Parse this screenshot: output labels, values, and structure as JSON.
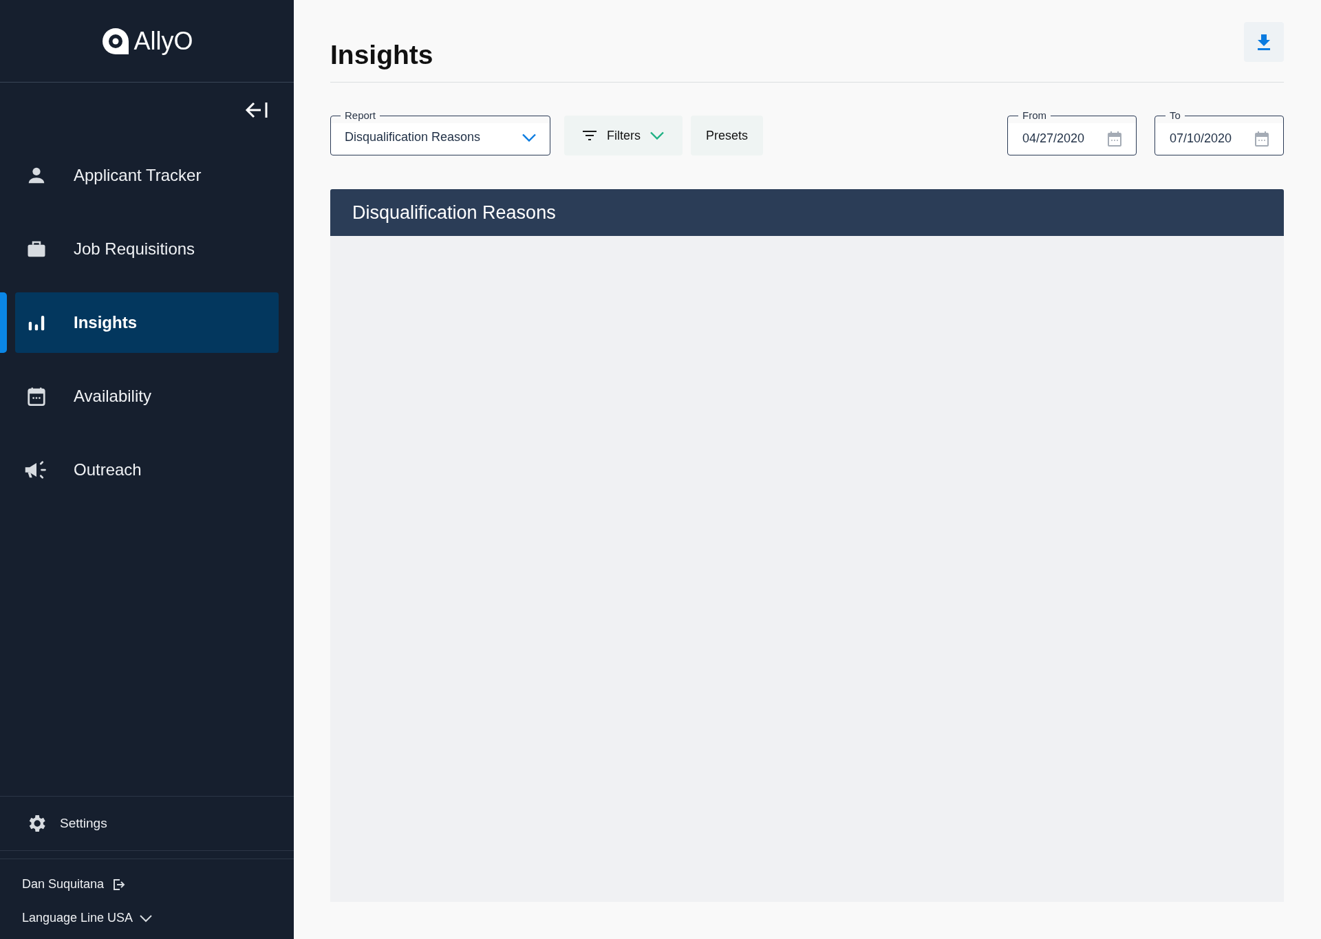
{
  "sidebar": {
    "logo": "AllyO",
    "nav_items": [
      {
        "label": "Applicant Tracker",
        "selected": false
      },
      {
        "label": "Job Requisitions",
        "selected": false
      },
      {
        "label": "Insights",
        "selected": true
      },
      {
        "label": "Availability",
        "selected": false
      },
      {
        "label": "Outreach",
        "selected": false
      }
    ],
    "settings": "Settings",
    "user": "Dan Suquitana",
    "organization": "Language Line USA"
  },
  "page": {
    "title": "Insights",
    "report": {
      "label": "Report",
      "value": "Disqualification Reasons"
    },
    "filters_button": "Filters",
    "presets_button": "Presets",
    "date_from": {
      "label": "From",
      "value": "04/27/2020"
    },
    "date_to": {
      "label": "To",
      "value": "07/10/2020"
    },
    "panel": {
      "title": "Disqualification Reasons"
    }
  }
}
